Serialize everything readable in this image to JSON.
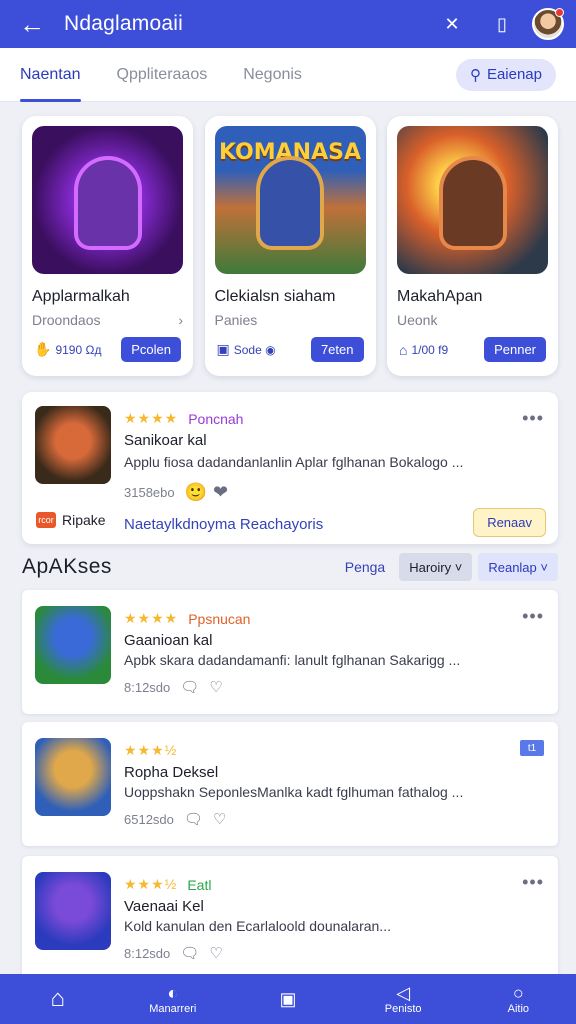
{
  "header": {
    "title": "Ndaglamoaii",
    "back_icon": "arrow-left-icon",
    "actions": [
      "close-icon",
      "tablet-icon"
    ]
  },
  "tabs": {
    "items": [
      "Naentan",
      "Qppliteraaos",
      "Negonis"
    ],
    "active": 0,
    "search_label": "Eaienap"
  },
  "featured": [
    {
      "art_title": "",
      "name": "Applarmalkah",
      "sub": "Droondaos",
      "meta": "9190 Ωд",
      "button": "Pcolen"
    },
    {
      "art_title": "KOMANASA",
      "name": "Clekialsn siaham",
      "sub": "Panies",
      "meta": "Sode ◉",
      "button": "7eten"
    },
    {
      "art_title": "",
      "name": "MakahApan",
      "sub": "Ueonk",
      "meta": "1/00 f9",
      "button": "Penner"
    }
  ],
  "review": {
    "stars": "★★★★",
    "tag": "Poncnah",
    "title": "Sanikoar kal",
    "desc": "Applu fiosa dadandanlanlin Aplar fglhanan Bokalogo ...",
    "foot": "3158ebo",
    "brand": "Ripake",
    "brand_logo": "rcor",
    "brand_link": "Naetaylkdnoyma Reachayoris",
    "button": "Renaav"
  },
  "section": {
    "title": "ApAKses",
    "link": "Pengа",
    "link_suffix": " ",
    "chip1": "Haroiry",
    "chip2": "Reanlap"
  },
  "items": [
    {
      "stars": "★★★★",
      "tag": "Ppsnucan",
      "tag_color": "#e0622a",
      "title": "Gaanioan kal",
      "desc": "Apbk skara dadandamanfi: lanult fglhanan Sakarigg ...",
      "foot": "8:12sdo",
      "flag": ""
    },
    {
      "stars": "★★★½",
      "tag": "",
      "tag_color": "#e0622a",
      "title": "Ropha Deksel",
      "desc": "Uoppshakn SeponlesManlka kadt fglhuman fathalog ...",
      "foot": "6512sdo",
      "flag": "t1"
    },
    {
      "stars": "★★★½",
      "tag": "Eatl",
      "tag_color": "#2aa84a",
      "title": "Vaenaai Kel",
      "desc": "Kold kanulan den Ecarlaloold dounalaran...",
      "foot": "8:12sdo",
      "flag": ""
    }
  ],
  "bottom_nav": [
    {
      "icon": "home-icon",
      "label": ""
    },
    {
      "icon": "compass-icon",
      "label": "Manarreri"
    },
    {
      "icon": "square-icon",
      "label": ""
    },
    {
      "icon": "bag-icon",
      "label": "Penisto"
    },
    {
      "icon": "circle-icon",
      "label": "Aitio"
    }
  ],
  "colors": {
    "primary": "#3d4fd8",
    "star": "#f5b82e",
    "background": "#eef0f6"
  }
}
